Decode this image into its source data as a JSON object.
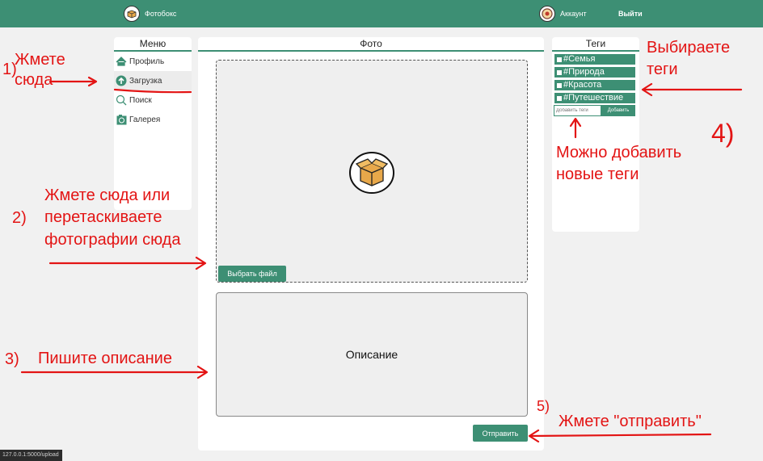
{
  "header": {
    "brand": "Фотобокс",
    "account": "Аккаунт",
    "logout": "Выйти"
  },
  "menu": {
    "title": "Меню",
    "items": [
      {
        "label": "Профиль",
        "icon": "home-icon"
      },
      {
        "label": "Загрузка",
        "icon": "upload-icon",
        "active": true
      },
      {
        "label": "Поиск",
        "icon": "search-icon"
      },
      {
        "label": "Галерея",
        "icon": "gallery-icon"
      }
    ]
  },
  "photo": {
    "title": "Фото",
    "choose_file": "Выбрать файл",
    "description_placeholder": "Описание",
    "send": "Отправить"
  },
  "tags": {
    "title": "Теги",
    "items": [
      "#Семья",
      "#Природа",
      "#Красота",
      "#Путешествие"
    ],
    "input_placeholder": "Добавить теги",
    "add_button": "Добавить"
  },
  "status": {
    "url": "127.0.0.1:5000/upload"
  },
  "annotations": {
    "n1": "1)",
    "step1_line1": "Жмете",
    "step1_line2": "сюда",
    "n2": "2)",
    "step2_line1": "Жмете сюда или",
    "step2_line2": "перетаскиваете",
    "step2_line3": "фотографии сюда",
    "n3": "3)",
    "step3": "Пишите описание",
    "n4": "4)",
    "step4_line1": "Выбираете",
    "step4_line2": "теги",
    "step4b_line1": "Можно добавить",
    "step4b_line2": "новые теги",
    "n5": "5)",
    "step5": "Жмете \"отправить\""
  },
  "colors": {
    "accent": "#3d8f74",
    "annotation": "#e31414",
    "background": "#f1f1f1"
  }
}
